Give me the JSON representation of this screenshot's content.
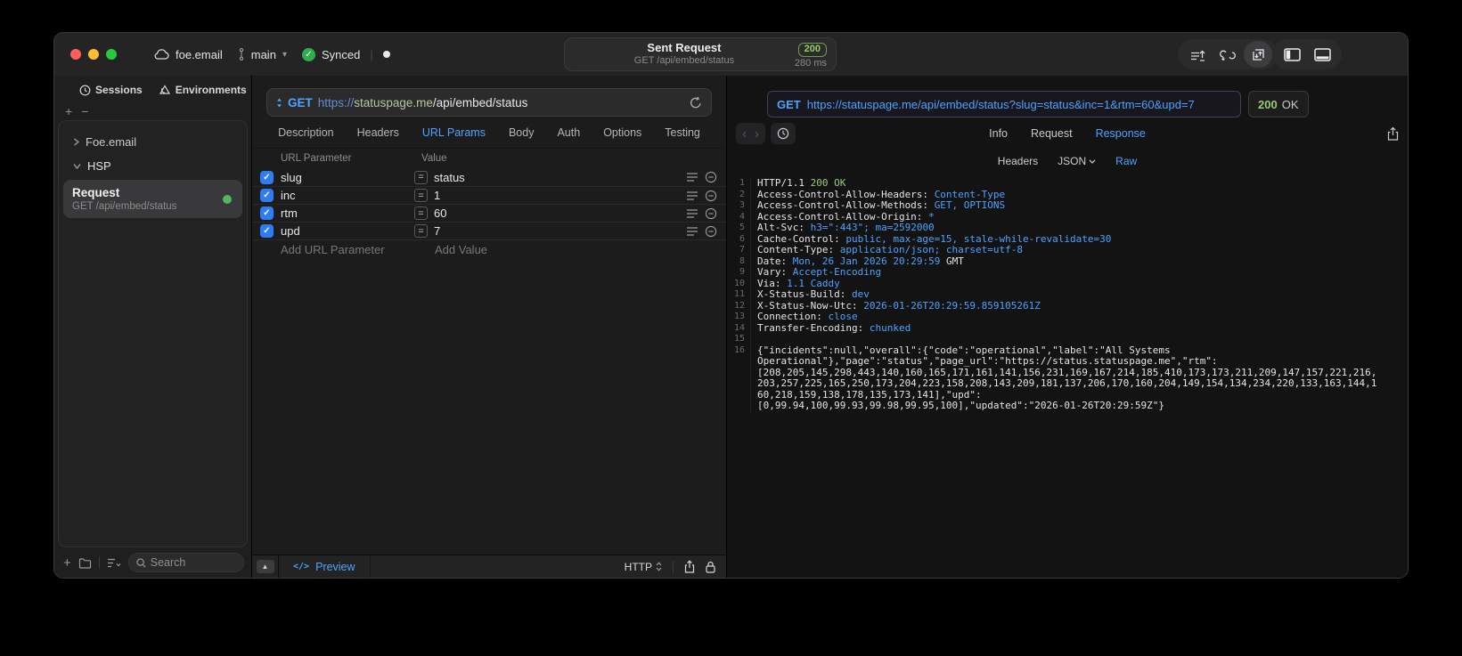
{
  "colors": {
    "accent": "#4da3ff",
    "success_green": "#9acb6d",
    "indicator_green": "#55b45e",
    "checkbox_blue": "#2f7cf7"
  },
  "titlebar": {
    "project": "foe.email",
    "branch": "main",
    "sync_status": "Synced",
    "center": {
      "title": "Sent Request",
      "subtitle": "GET /api/embed/status",
      "status_code": "200",
      "duration": "280 ms"
    }
  },
  "sidebar": {
    "tabs": {
      "sessions": "Sessions",
      "environments": "Environments"
    },
    "tree": {
      "group1": "Foe.email",
      "group2": "HSP"
    },
    "selected_request": {
      "title": "Request",
      "subtitle": "GET /api/embed/status"
    },
    "search_placeholder": "Search"
  },
  "request_panel": {
    "method": "GET",
    "url_scheme": "https://",
    "url_host": "statuspage.me",
    "url_path": "/api/embed/status",
    "tabs": [
      "Description",
      "Headers",
      "URL Params",
      "Body",
      "Auth",
      "Options",
      "Testing"
    ],
    "active_tab": "URL Params",
    "params": {
      "col_name": "URL Parameter",
      "col_value": "Value",
      "rows": [
        {
          "name": "slug",
          "value": "status",
          "checked": true
        },
        {
          "name": "inc",
          "value": "1",
          "checked": true
        },
        {
          "name": "rtm",
          "value": "60",
          "checked": true
        },
        {
          "name": "upd",
          "value": "7",
          "checked": true
        }
      ],
      "add_name_placeholder": "Add URL Parameter",
      "add_value_placeholder": "Add Value"
    },
    "footer": {
      "preview_code": "</>",
      "preview_label": "Preview",
      "protocol": "HTTP"
    }
  },
  "response_panel": {
    "method": "GET",
    "url": "https://statuspage.me/api/embed/status?slug=status&inc=1&rtm=60&upd=7",
    "status_code": "200",
    "status_text": "OK",
    "tabs": [
      "Info",
      "Request",
      "Response"
    ],
    "active_tab": "Response",
    "subtabs": [
      "Headers",
      "JSON",
      "Raw"
    ],
    "active_subtab": "Raw",
    "lines": [
      {
        "n": "1",
        "parts": [
          [
            "HTTP/1.1 ",
            "k"
          ],
          [
            "200 OK",
            "g"
          ]
        ]
      },
      {
        "n": "2",
        "parts": [
          [
            "Access-Control-Allow-Headers: ",
            "k"
          ],
          [
            "Content-Type",
            "v"
          ]
        ]
      },
      {
        "n": "3",
        "parts": [
          [
            "Access-Control-Allow-Methods: ",
            "k"
          ],
          [
            "GET, OPTIONS",
            "v"
          ]
        ]
      },
      {
        "n": "4",
        "parts": [
          [
            "Access-Control-Allow-Origin: ",
            "k"
          ],
          [
            "*",
            "v"
          ]
        ]
      },
      {
        "n": "5",
        "parts": [
          [
            "Alt-Svc: ",
            "k"
          ],
          [
            "h3=\":443\"; ma=2592000",
            "v"
          ]
        ]
      },
      {
        "n": "6",
        "parts": [
          [
            "Cache-Control: ",
            "k"
          ],
          [
            "public, max-age=15, stale-while-revalidate=30",
            "v"
          ]
        ]
      },
      {
        "n": "7",
        "parts": [
          [
            "Content-Type: ",
            "k"
          ],
          [
            "application/json; charset=utf-8",
            "v"
          ]
        ]
      },
      {
        "n": "8",
        "parts": [
          [
            "Date: ",
            "k"
          ],
          [
            "Mon, 26 Jan 2026 20:29:59",
            "v"
          ],
          [
            " GMT",
            "k"
          ]
        ]
      },
      {
        "n": "9",
        "parts": [
          [
            "Vary: ",
            "k"
          ],
          [
            "Accept-Encoding",
            "v"
          ]
        ]
      },
      {
        "n": "10",
        "parts": [
          [
            "Via: ",
            "k"
          ],
          [
            "1.1 Caddy",
            "v"
          ]
        ]
      },
      {
        "n": "11",
        "parts": [
          [
            "X-Status-Build: ",
            "k"
          ],
          [
            "dev",
            "v"
          ]
        ]
      },
      {
        "n": "12",
        "parts": [
          [
            "X-Status-Now-Utc: ",
            "k"
          ],
          [
            "2026-01-26T20:29:59.859105261Z",
            "v"
          ]
        ]
      },
      {
        "n": "13",
        "parts": [
          [
            "Connection: ",
            "k"
          ],
          [
            "close",
            "v"
          ]
        ]
      },
      {
        "n": "14",
        "parts": [
          [
            "Transfer-Encoding: ",
            "k"
          ],
          [
            "chunked",
            "v"
          ]
        ]
      },
      {
        "n": "15",
        "parts": []
      },
      {
        "n": "16",
        "parts": [
          [
            "{\"incidents\":null,\"overall\":{\"code\":\"operational\",\"label\":\"All Systems",
            "k"
          ]
        ]
      },
      {
        "n": "",
        "parts": [
          [
            "Operational\"},\"page\":\"status\",\"page_url\":\"https://status.statuspage.me\",\"rtm\":",
            "k"
          ]
        ]
      },
      {
        "n": "",
        "parts": [
          [
            "[208,205,145,298,443,140,160,165,171,161,141,156,231,169,167,214,185,410,173,173,211,209,147,157,221,216,",
            "k"
          ]
        ]
      },
      {
        "n": "",
        "parts": [
          [
            "203,257,225,165,250,173,204,223,158,208,143,209,181,137,206,170,160,204,149,154,134,234,220,133,163,144,1",
            "k"
          ]
        ]
      },
      {
        "n": "",
        "parts": [
          [
            "60,218,159,138,178,135,173,141],\"upd\":",
            "k"
          ]
        ]
      },
      {
        "n": "",
        "parts": [
          [
            "[0,99.94,100,99.93,99.98,99.95,100],\"updated\":\"2026-01-26T20:29:59Z\"}",
            "k"
          ]
        ]
      }
    ]
  }
}
